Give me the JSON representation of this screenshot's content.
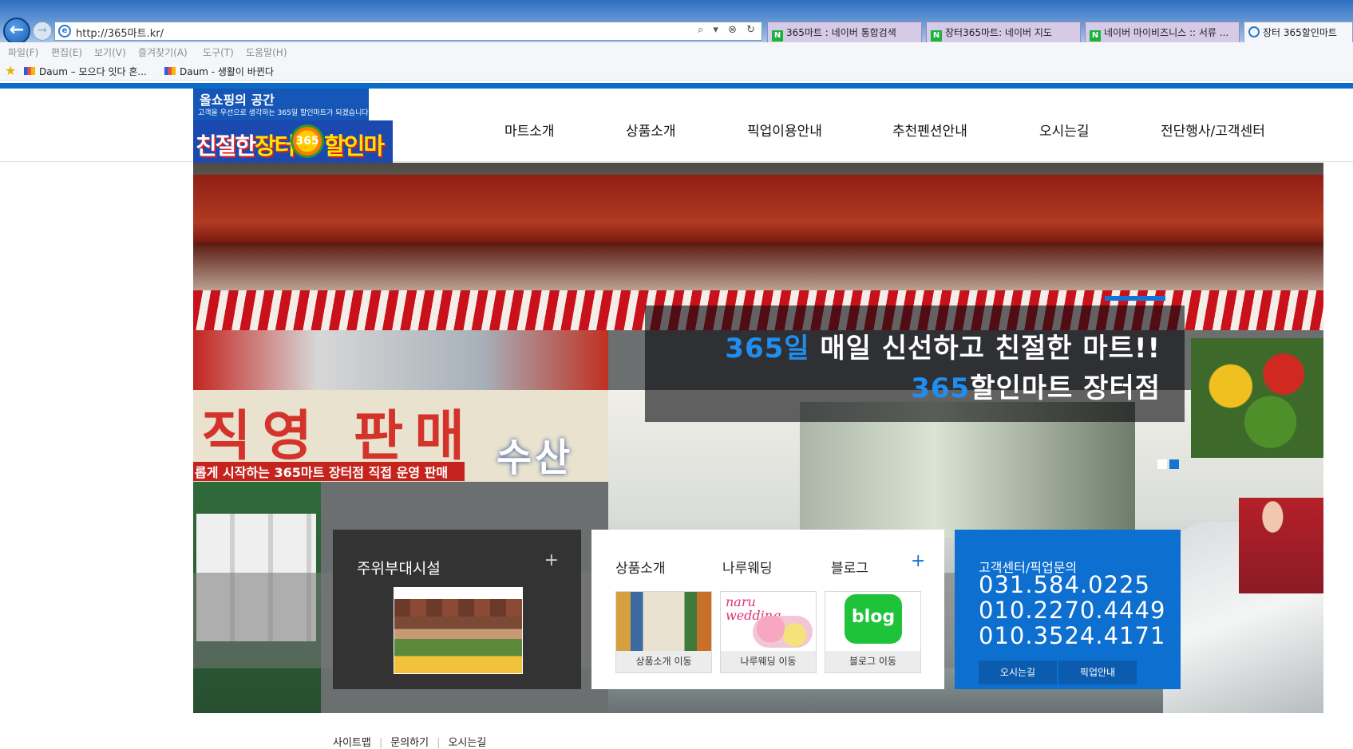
{
  "browser": {
    "address_url": "http://365마트.kr/",
    "address_tools": "⌕ ▾ ⊗ ↻",
    "tabs": [
      {
        "label": "365마트 : 네이버 통합검색"
      },
      {
        "label": "장터365마트: 네이버 지도"
      },
      {
        "label": "네이버 마이비즈니스 :: 서류 ..."
      },
      {
        "label": "장터 365할인마트"
      }
    ],
    "menu": [
      "파일(F)",
      "편집(E)",
      "보기(V)",
      "즐겨찾기(A)",
      "도구(T)",
      "도움말(H)"
    ],
    "favorites": [
      {
        "label": "Daum – 모으다 잇다 흔..."
      },
      {
        "label": "Daum - 생활이 바뀐다"
      }
    ]
  },
  "site": {
    "logo": {
      "line1": "올쇼핑의 공간",
      "line2": "고객을 우선으로 생각하는 365일 할인마트가 되겠습니다",
      "word1": "친절한",
      "word2": "장터",
      "badge": "365",
      "word3": "할인마트"
    },
    "nav": [
      "마트소개",
      "상품소개",
      "픽업이용안내",
      "추천펜션안내",
      "오시는길",
      "전단행사/고객센터"
    ],
    "hero": {
      "storefront_big": "직영 판매",
      "storefront_sub": "롭게 시작하는 365마트 장터점 직접 운영 판매",
      "storefront_sea": "수산",
      "caption_line1_highlight": "365일",
      "caption_line1_rest": " 매일 신선하고 친절한 마트!!",
      "caption_line2_highlight": "365",
      "caption_line2_rest": "할인마트 장터점"
    },
    "facilities": {
      "title": "주위부대시설",
      "plus": "+"
    },
    "links": {
      "tabs": [
        "상품소개",
        "나루웨딩",
        "블로그"
      ],
      "plus": "+",
      "wedding_logo": "naru\nwedding",
      "blog_logo": "blog",
      "cards": [
        {
          "caption": "상품소개 이동"
        },
        {
          "caption": "나루웨딩 이동"
        },
        {
          "caption": "블로그 이동"
        }
      ]
    },
    "contact": {
      "title": "고객센터/픽업문의",
      "phones": [
        "031.584.0225",
        "010.2270.4449",
        "010.3524.4171"
      ],
      "buttons": [
        "오시는길",
        "픽업안내"
      ]
    },
    "footer": [
      "사이트맵",
      "문의하기",
      "오시는길"
    ]
  }
}
